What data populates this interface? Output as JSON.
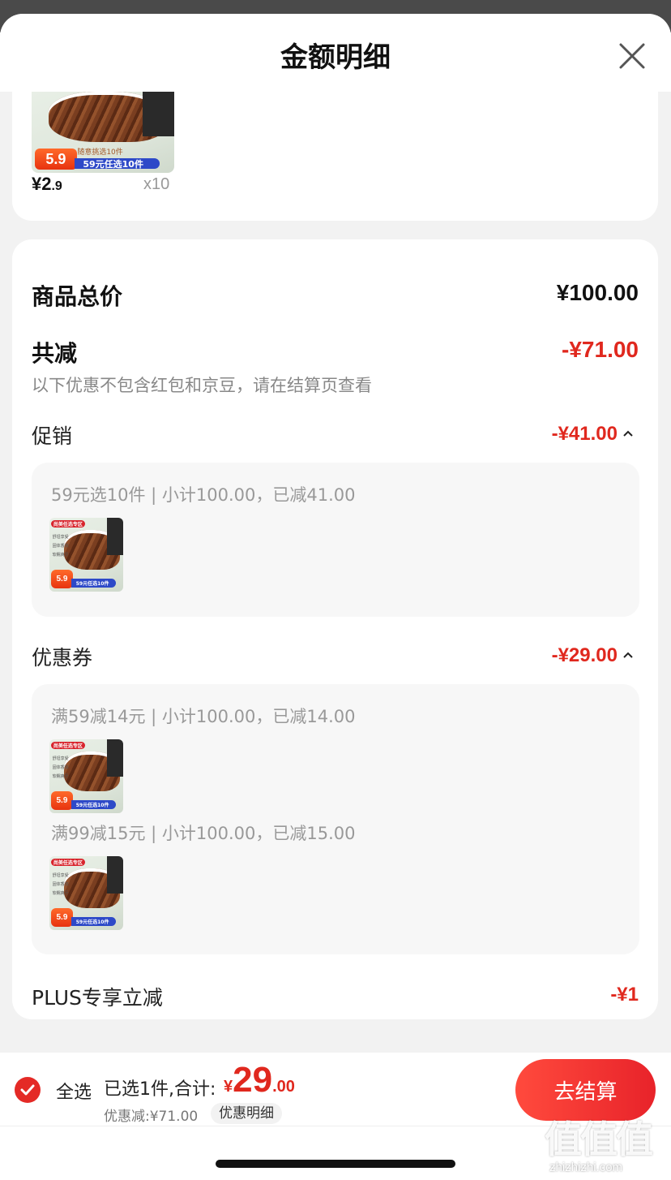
{
  "sheet": {
    "title": "金额明细",
    "close_icon": "close-icon"
  },
  "product": {
    "price_int": "¥2",
    "price_dec": ".9",
    "qty": "x10",
    "image": {
      "price_chip": "5.9",
      "sub_tag": "随意挑选10件",
      "promo_tag": "59元任选10件",
      "zone_tag": "尚美任选专区",
      "features": [
        "舒坦享受",
        "固体香浓",
        "软糯爽牙"
      ]
    }
  },
  "summary": {
    "goods_total_label": "商品总价",
    "goods_total_value": "¥100.00",
    "total_reduce_label": "共减",
    "total_reduce_value": "-¥71.00",
    "note": "以下优惠不包含红包和京豆，请在结算页查看",
    "promo": {
      "label": "促销",
      "value": "-¥41.00",
      "line": "59元选10件 | 小计100.00，已减41.00"
    },
    "coupon": {
      "label": "优惠券",
      "value": "-¥29.00",
      "line1": "满59减14元 | 小计100.00，已减14.00",
      "line2": "满99减15元 | 小计100.00，已减15.00"
    },
    "plus": {
      "label": "PLUS专享立减",
      "value": "-¥1"
    }
  },
  "bottom": {
    "select_all": "全选",
    "selected_text": "已选1件,合计:",
    "total_cur": "¥",
    "total_int": "29",
    "total_dec": ".00",
    "discount_text": "优惠减:¥71.00",
    "discount_detail": "优惠明细",
    "checkout": "去结算"
  },
  "watermark": {
    "logo": "值值值",
    "url": "zhizhizhi.com"
  },
  "colors": {
    "accent_red": "#e0281e",
    "checkout_gradient_start": "#ff4a3d",
    "checkout_gradient_end": "#e8232a"
  }
}
